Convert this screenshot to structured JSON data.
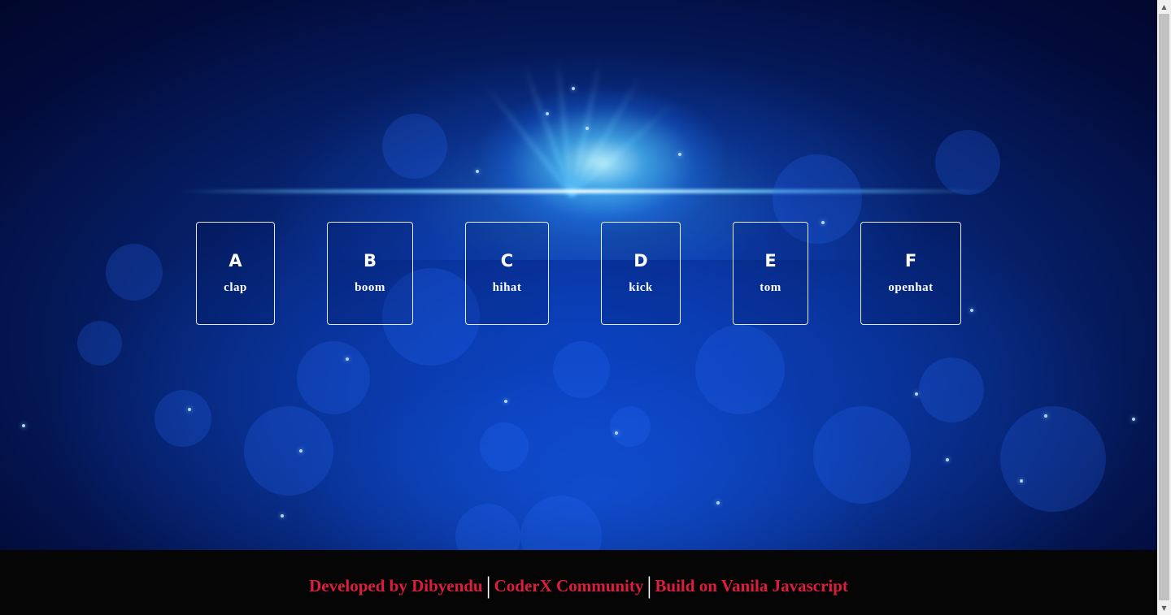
{
  "keys": [
    {
      "letter": "A",
      "sound": "clap"
    },
    {
      "letter": "B",
      "sound": "boom"
    },
    {
      "letter": "C",
      "sound": "hihat"
    },
    {
      "letter": "D",
      "sound": "kick"
    },
    {
      "letter": "E",
      "sound": "tom"
    },
    {
      "letter": "F",
      "sound": "openhat"
    }
  ],
  "footer": {
    "developer": "Developed by Dibyendu",
    "community": "CoderX Community",
    "tech": "Build on Vanila Javascript",
    "separator": "|"
  },
  "scrollbar": {
    "up_icon": "triangle-up-icon",
    "down_icon": "triangle-down-icon"
  },
  "colors": {
    "accent_text": "#dc1e3c",
    "key_border": "#ffffff",
    "footer_bg": "#050505",
    "background_deep": "#020b3a",
    "background_mid": "#0a3ab0"
  }
}
